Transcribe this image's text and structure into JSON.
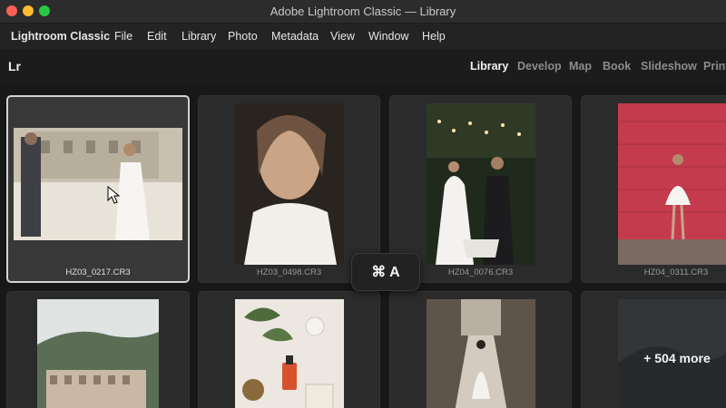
{
  "window": {
    "title": "Adobe Lightroom Classic — Library"
  },
  "menubar": {
    "items": [
      "Lightroom Classic",
      "File",
      "Edit",
      "Library",
      "Photo",
      "Metadata",
      "View",
      "Window",
      "Help"
    ]
  },
  "modulebar": {
    "logo": "Lr",
    "modules": [
      "Library",
      "Develop",
      "Map",
      "Book",
      "Slideshow",
      "Print"
    ],
    "active_module": "Library"
  },
  "grid": {
    "photos": [
      {
        "filename": "HZ03_0217.CR3",
        "selected": true
      },
      {
        "filename": "HZ03_0498.CR3",
        "selected": false
      },
      {
        "filename": "HZ04_0076.CR3",
        "selected": false
      },
      {
        "filename": "HZ04_0311.CR3",
        "selected": false
      }
    ],
    "more_label": "+ 504 more"
  },
  "shortcut_overlay": {
    "keys": "⌘ A"
  },
  "colors": {
    "background": "#1e1e1e",
    "cell": "#2b2b2b",
    "selected_border": "#d4d4d4",
    "accent_red": "#c43b4e"
  }
}
